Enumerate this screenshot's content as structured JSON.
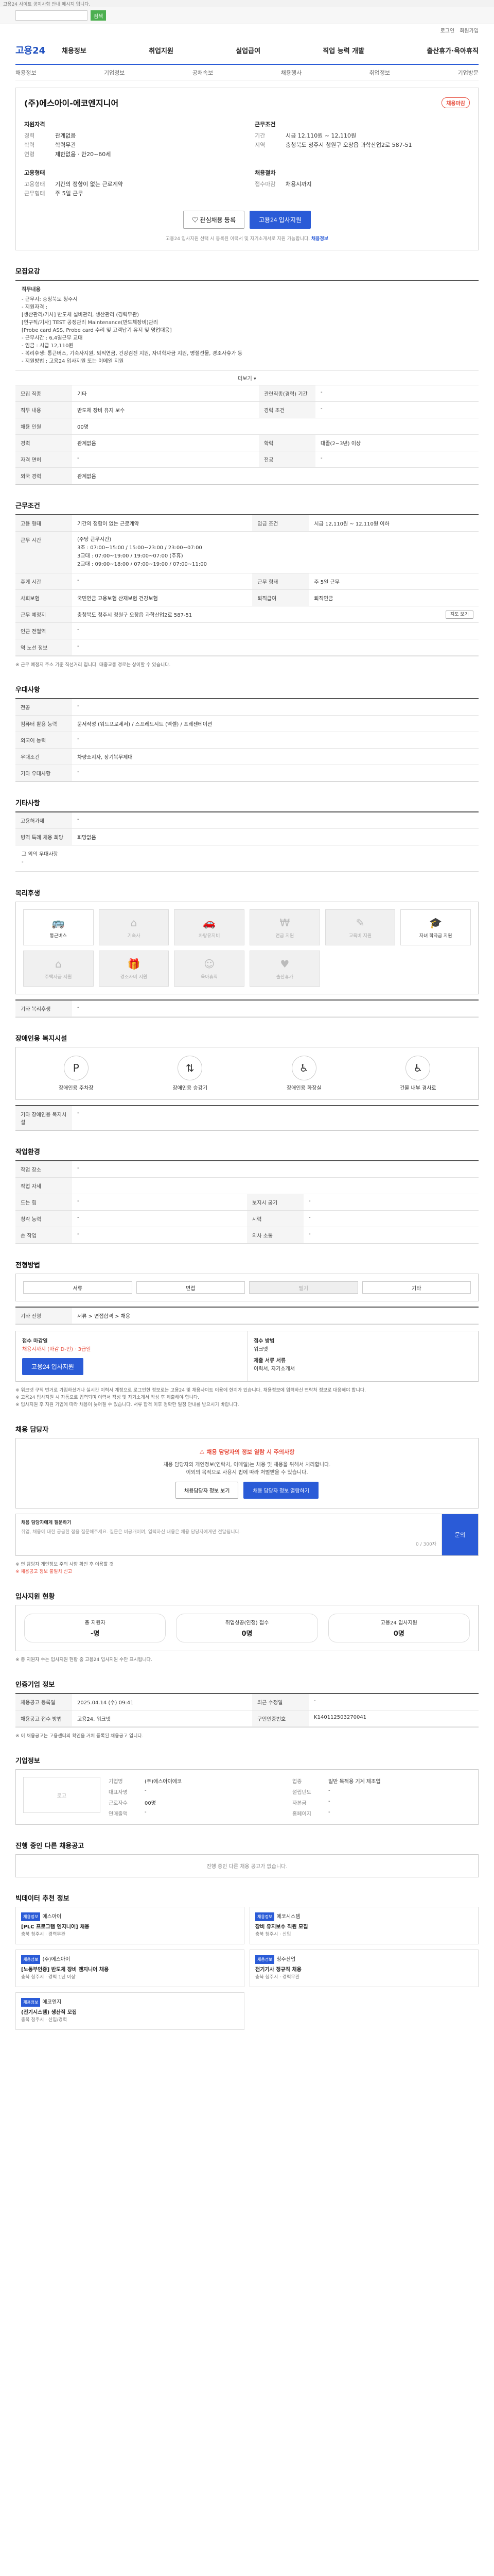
{
  "notice": "고용24 사이트 공지사항 안내 메시지 입니다.",
  "search": {
    "placeholder": "",
    "button": "검색"
  },
  "util_links": [
    "로그인",
    "회원가입"
  ],
  "logo": "고용24",
  "gnb": [
    "채용정보",
    "취업지원",
    "실업급여",
    "직업 능력 개발",
    "출산휴가·육아휴직"
  ],
  "sub_gnb": [
    "채용정보",
    "기업정보",
    "공채속보",
    "채용행사",
    "취업정보",
    "기업방문"
  ],
  "company": {
    "title": "(주)에스아이-에코엔지니어",
    "badge": "채용마감",
    "left_section": "지원자격",
    "left_rows": [
      {
        "k": "경력",
        "v": "관계없음"
      },
      {
        "k": "학력",
        "v": "학력무관"
      },
      {
        "k": "연령",
        "v": "제한없음 · 만20~60세"
      }
    ],
    "right_section": "근무조건",
    "right_rows": [
      {
        "k": "기간",
        "v": "시급 12,110원 ~ 12,110원"
      },
      {
        "k": "지역",
        "v": "충청북도 청주시 청원구 오창읍 과학산업2로 587-51"
      }
    ],
    "left_section2": "고용형태",
    "left_rows2": [
      {
        "k": "고용형태",
        "v": "기간의 정함이 없는 근로계약"
      },
      {
        "k": "근무형태",
        "v": "주 5일 근무"
      }
    ],
    "right_section2": "채용절차",
    "right_rows2": [
      {
        "k": "접수마감",
        "v": "채용시까지"
      }
    ],
    "btn_interest": "관심채용 등록",
    "btn_apply": "고용24 입사지원",
    "note_prefix": "고용24 입사지원 선택 시 등록된 이력서 및 자기소개서로 지원 가능합니다.",
    "note_link": "채용정보"
  },
  "sections": {
    "job_content": "모집요강",
    "work_cond": "근무조건",
    "prefer": "우대사항",
    "other": "기타사항",
    "welfare": "복리후생",
    "disability": "장애인용 복지시설",
    "work_env": "작업환경",
    "process": "전형방법",
    "contact": "채용 담당자",
    "stats": "입사지원 현황",
    "manage": "인증기업 정보",
    "company_info": "기업정보",
    "others_jobs": "진행 중인 다른 채용공고",
    "recommend": "빅데이터 추천 정보"
  },
  "job_content": {
    "lines": [
      "직무내용",
      "- 근무지: 충청북도 청주시",
      "- 지원자격 :",
      "[생산관리/기사] 반도체 설비관리, 생산관리 (경력무관)",
      "[연구직/기사] TEST 공정관리 Maintenance(반도체장비)관리",
      "[Probe card ASS, Probe card 수리 및 고객납기 유지 및 영업대응]",
      "- 근무시간 : 6,4일근무 교대",
      "- 임금 : 시급 12,110원",
      "- 복리후생: 통근버스, 기숙사지원, 퇴직연금, 건강검진 지원, 자녀학자금 지원, 명절선물, 경조사휴가 등",
      "- 지원방법 : 고용24 입사지원 또는 이메일 지원"
    ],
    "more": "더보기"
  },
  "job_table": [
    {
      "k": "모집 직종",
      "v": "기타",
      "k2": "관련직종(경력) 기간",
      "v2": "-"
    },
    {
      "k": "직무 내용",
      "v": "반도체 장비 유지 보수",
      "k2": "경력 조건",
      "v2": "-"
    },
    {
      "k": "채용 인원",
      "v": "00명",
      "k2": "",
      "v2": ""
    },
    {
      "k": "경력",
      "v": "관계없음",
      "k2": "학력",
      "v2": "대졸(2~3년) 이상"
    },
    {
      "k": "자격 면허",
      "v": "-",
      "k2": "전공",
      "v2": "-"
    },
    {
      "k": "외국 경력",
      "v": "관계없음",
      "k2": "",
      "v2": ""
    }
  ],
  "work_table": [
    {
      "k": "고용 형태",
      "v": "기간의 정함이 없는 근로계약",
      "k2": "임금 조건",
      "v2": "시급 12,110원 ~ 12,110원 이하"
    },
    {
      "k": "근무 시간",
      "v": "(주당 근무시간)\n3조 : 07:00~15:00 / 15:00~23:00 / 23:00~07:00\n3교대 : 07:00~19:00 / 19:00~07:00 (주휴)\n2교대 : 09:00~18:00 / 07:00~19:00 / 07:00~11:00",
      "k2": "",
      "v2": ""
    },
    {
      "k": "휴게 시간",
      "v": "-",
      "k2": "근무 형태",
      "v2": "주 5일 근무"
    },
    {
      "k": "사회보험",
      "v": "국민연금 고용보험 산재보험 건강보험",
      "k2": "퇴직급여",
      "v2": "퇴직연금"
    },
    {
      "k": "근무 예정지",
      "v": "충청북도 청주시 청원구 오창읍 과학산업2로 587-51",
      "k2": "",
      "v2": "지도 보기"
    },
    {
      "k": "인근 전철역",
      "v": "-",
      "k2": "",
      "v2": ""
    },
    {
      "k": "역 노선 정보",
      "v": "-",
      "k2": "",
      "v2": ""
    }
  ],
  "work_note": "※ 근무 예정지 주소 기준 직선거리 입니다. 대중교통 경로는 상이할 수 있습니다.",
  "prefer_table": [
    {
      "k": "전공",
      "v": "-"
    },
    {
      "k": "컴퓨터 활용 능력",
      "v": "문서작성 (워드프로세서) / 스프레드시트 (엑셀) / 프레젠테이션"
    },
    {
      "k": "외국어 능력",
      "v": "-"
    },
    {
      "k": "우대조건",
      "v": "차량소지자, 장기복무제대"
    },
    {
      "k": "기타 우대사항",
      "v": "-"
    }
  ],
  "other_table": [
    {
      "k": "고용허가제",
      "v": "-"
    },
    {
      "k": "병역 특례 채용 희망",
      "v": "희망없음"
    }
  ],
  "other_more": "그 외의 우대사항",
  "welfare_items": [
    {
      "label": "통근버스",
      "icon": "bus-icon",
      "on": true
    },
    {
      "label": "기숙사",
      "icon": "dorm-icon",
      "on": false
    },
    {
      "label": "차량유지비",
      "icon": "car-icon",
      "on": false
    },
    {
      "label": "연금 지원",
      "icon": "pension-icon",
      "on": false
    },
    {
      "label": "교육비 지원",
      "icon": "edu-icon",
      "on": false
    },
    {
      "label": "자녀 학자금 지원",
      "icon": "grad-cap-icon",
      "on": true
    },
    {
      "label": "주택자금 지원",
      "icon": "house-icon",
      "on": false
    },
    {
      "label": "경조사비 지원",
      "icon": "gift-icon",
      "on": false
    },
    {
      "label": "육아휴직",
      "icon": "baby-icon",
      "on": false
    },
    {
      "label": "출산휴가",
      "icon": "heart-icon",
      "on": false
    }
  ],
  "welfare_other_label": "기타 복리후생",
  "disability_items": [
    {
      "label": "장애인용 주차장",
      "icon": "parking-icon"
    },
    {
      "label": "장애인용 승강기",
      "icon": "elevator-icon"
    },
    {
      "label": "장애인용 화장실",
      "icon": "restroom-icon"
    },
    {
      "label": "건물 내부 경사로",
      "icon": "ramp-icon"
    }
  ],
  "disability_other_label": "기타 장애인용 복지시설",
  "env_table": [
    {
      "k": "작업 장소",
      "v": "-",
      "k2": "",
      "v2": ""
    },
    {
      "k": "작업 자세",
      "v": "",
      "k2": "",
      "v2": ""
    },
    {
      "k": "드는 힘",
      "v": "-",
      "k2": "보지시 굽기",
      "v2": "-"
    },
    {
      "k": "청각 능력",
      "v": "-",
      "k2": "시력",
      "v2": "-"
    },
    {
      "k": "손 작업",
      "v": "-",
      "k2": "의사 소통",
      "v2": "-"
    }
  ],
  "process": {
    "steps": [
      {
        "l": "서류",
        "on": true
      },
      {
        "l": "면접",
        "on": true
      },
      {
        "l": "필기",
        "on": false
      },
      {
        "l": "기타",
        "on": true
      }
    ],
    "docs_label": "기타 전형",
    "docs_text": "서류 > 면접합격 > 채용",
    "apply_label": "접수 마감일",
    "apply_value": "채용시까지 (마감 D-인) · 3급일",
    "method_label": "접수 방법",
    "method_value": "워크넷",
    "submit_label": "제출 서류 서류",
    "submit_value": "이력서, 자기소개서",
    "apply_btn": "고용24 입사지원",
    "notes": [
      "※ 워크넷 구직 번거로 가입하셨거나 실시간 이력서 계정으로 로그인한 정보로는 고용24 및 채용사이트 이용에 한계가 있습니다. 채용정보에 입력하신 연락처 정보로 대응해야 합니다.",
      "※ 고용24 입사지원 시 자동으로 입력되며 이력서 작성 및 자기소개서 작성 후 제출해야 합니다.",
      "※ 입사지원 후 지원 기업에 따라 채용이 늦어질 수 있습니다. 서류 합격 이후 정확한 일정 안내를 받으시기 바랍니다."
    ]
  },
  "contact": {
    "warn_title": "채용 담당자의 정보 열람 시 주의사항",
    "warn_lines": [
      "채용 담당자의 개인정보(연락처, 이메일)는 채용 및 채용을 위해서 처리합니다.",
      "이외의 목적으로 사용시 법에 따라 처벌받을 수 있습니다."
    ],
    "btn_view": "채용담당자 정보 보기",
    "btn_confirm": "채용 담당자 정보 열람하기",
    "qa_label": "채용 담당자에게 질문하기",
    "qa_placeholder": "취업, 채용에 대한 궁금한 점을 질문해주세요. 질문은 비공개이며, 입력하신 내용은 채용 담당자에게만 전달됩니다.",
    "qa_count": "0 / 300자",
    "qa_btn": "문의",
    "notes": [
      "※ 연 담당자 개인정보 주의 사항 확인 후 이용할 것",
      "※ 채용공고 정보 불일치 신고"
    ]
  },
  "stats": [
    {
      "label": "총 지원자",
      "value": "-명"
    },
    {
      "label": "취업성공(인정) 접수",
      "value": "0명"
    },
    {
      "label": "고용24 입사지원",
      "value": "0명"
    }
  ],
  "stats_note": "※ 총 지원자 수는 입사지원 현황 중 고용24 입사지원 수만 표시됩니다.",
  "manage_table": [
    {
      "k": "채용공고 등록일",
      "v": "2025.04.14 (수) 09:41",
      "k2": "최근 수정일",
      "v2": "-"
    },
    {
      "k": "채용공고 접수 방법",
      "v": "고용24, 워크넷",
      "k2": "구인인증번호",
      "v2": "K140112503270041"
    }
  ],
  "manage_note": "※ 이 채용공고는 고용센터의 확인을 거쳐 등록된 채용공고 입니다.",
  "company_info": {
    "logo_text": "로고",
    "rows": [
      {
        "k": "기업명",
        "v": "(주)에스아이에코",
        "k2": "업종",
        "v2": "일반 목적용 기계 제조업"
      },
      {
        "k": "대표자명",
        "v": "-",
        "k2": "설립년도",
        "v2": "-"
      },
      {
        "k": "근로자수",
        "v": "00명",
        "k2": "자본금",
        "v2": "-"
      },
      {
        "k": "연매출액",
        "v": "-",
        "k2": "홈페이지",
        "v2": "-"
      }
    ]
  },
  "others_empty": "진행 중인 다른 채용 공고가 없습니다.",
  "recommend": [
    {
      "tag": "채용정보",
      "title": "[PLC 프로그램 엔지니어] 채용",
      "company": "에스아이",
      "meta": "충북 청주시 · 경력무관"
    },
    {
      "tag": "채용정보",
      "title": "장비 유지보수 직원 모집",
      "company": "에코시스템",
      "meta": "충북 청주시 · 신입"
    },
    {
      "tag": "채용정보",
      "title": "[노동부인증] 반도체 장비 엔지니어 채용",
      "company": "(주)에스아이",
      "meta": "충북 청주시 · 경력 1년 이상"
    },
    {
      "tag": "채용정보",
      "title": "전기기사 정규직 채용",
      "company": "청주산업",
      "meta": "충북 청주시 · 경력무관"
    },
    {
      "tag": "채용정보",
      "title": "(전기시스템) 생산직 모집",
      "company": "에코엔지",
      "meta": "충북 청주시 · 신입/경력"
    }
  ]
}
